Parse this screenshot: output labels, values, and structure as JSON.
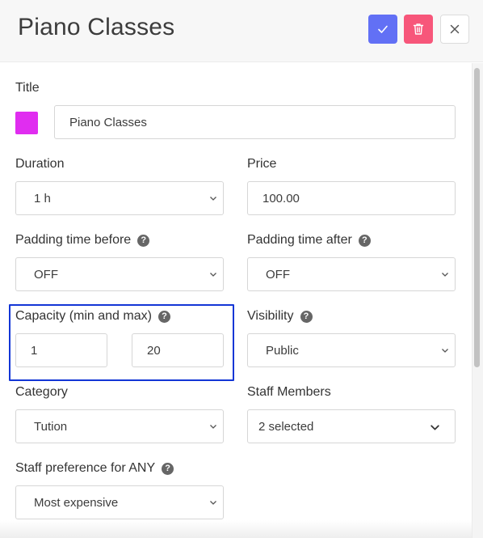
{
  "header": {
    "title": "Piano Classes"
  },
  "form": {
    "title_label": "Title",
    "title_value": "Piano Classes",
    "color": "#e02df0",
    "duration_label": "Duration",
    "duration_value": "1 h",
    "price_label": "Price",
    "price_value": "100.00",
    "padding_before_label": "Padding time before",
    "padding_before_value": "OFF",
    "padding_after_label": "Padding time after",
    "padding_after_value": "OFF",
    "capacity_label": "Capacity (min and max)",
    "capacity_min": "1",
    "capacity_max": "20",
    "visibility_label": "Visibility",
    "visibility_value": "Public",
    "category_label": "Category",
    "category_value": "Tution",
    "staff_label": "Staff Members",
    "staff_value": "2 selected",
    "staff_pref_label": "Staff preference for ANY",
    "staff_pref_value": "Most expensive"
  },
  "help_glyph": "?",
  "colors": {
    "save": "#6270f5",
    "delete": "#f7567a",
    "highlight": "#1336d6"
  }
}
